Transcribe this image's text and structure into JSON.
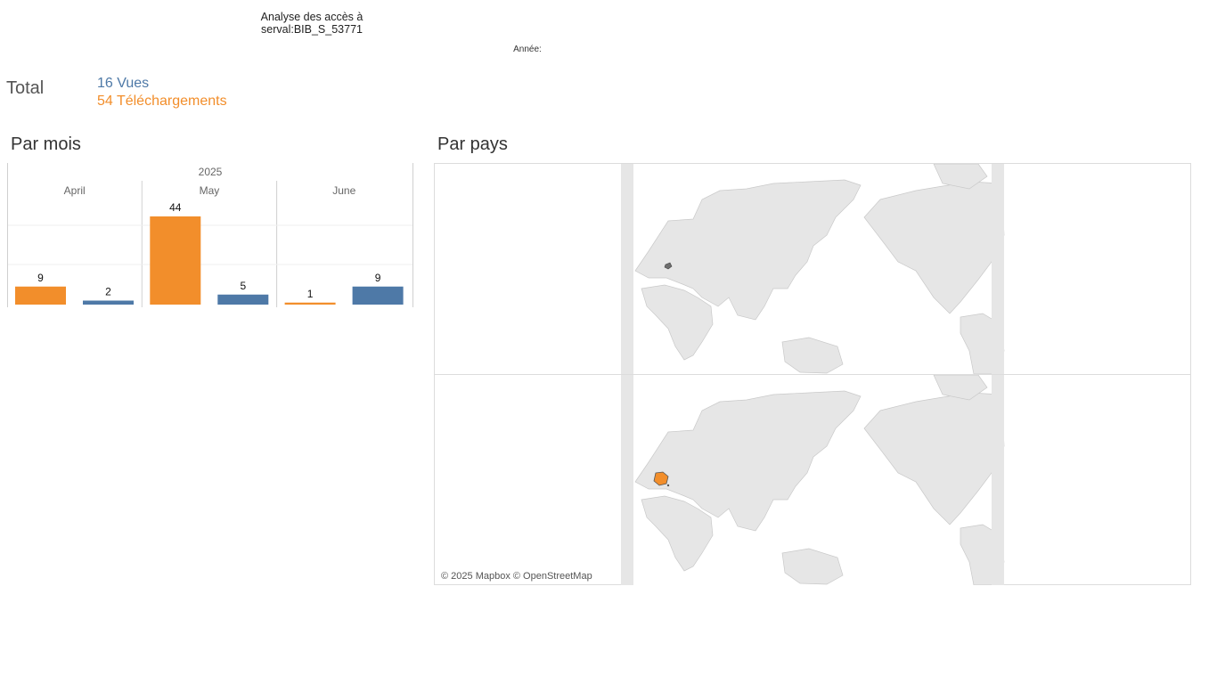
{
  "header": {
    "title_line1": "Analyse des accès à",
    "title_line2": "serval:BIB_S_53771",
    "year_filter_label": "Année:"
  },
  "totals": {
    "label": "Total",
    "views": "16 Vues",
    "downloads": "54 Téléchargements"
  },
  "sections": {
    "by_month": "Par mois",
    "by_country": "Par pays"
  },
  "colors": {
    "downloads": "#f28e2b",
    "views": "#4e79a7",
    "map_land": "#e8e8e8",
    "map_highlight_views": "#6e6e6e",
    "map_highlight_downloads": "#f28e2b"
  },
  "chart_data": {
    "type": "bar",
    "year": "2025",
    "categories": [
      "April",
      "May",
      "June"
    ],
    "series": [
      {
        "values": [
          9,
          44,
          1
        ]
      },
      {
        "values": [
          2,
          5,
          9
        ]
      }
    ]
  },
  "map": {
    "credit": "© 2025 Mapbox © OpenStreetMap",
    "panels": [
      "views-map",
      "downloads-map"
    ]
  }
}
